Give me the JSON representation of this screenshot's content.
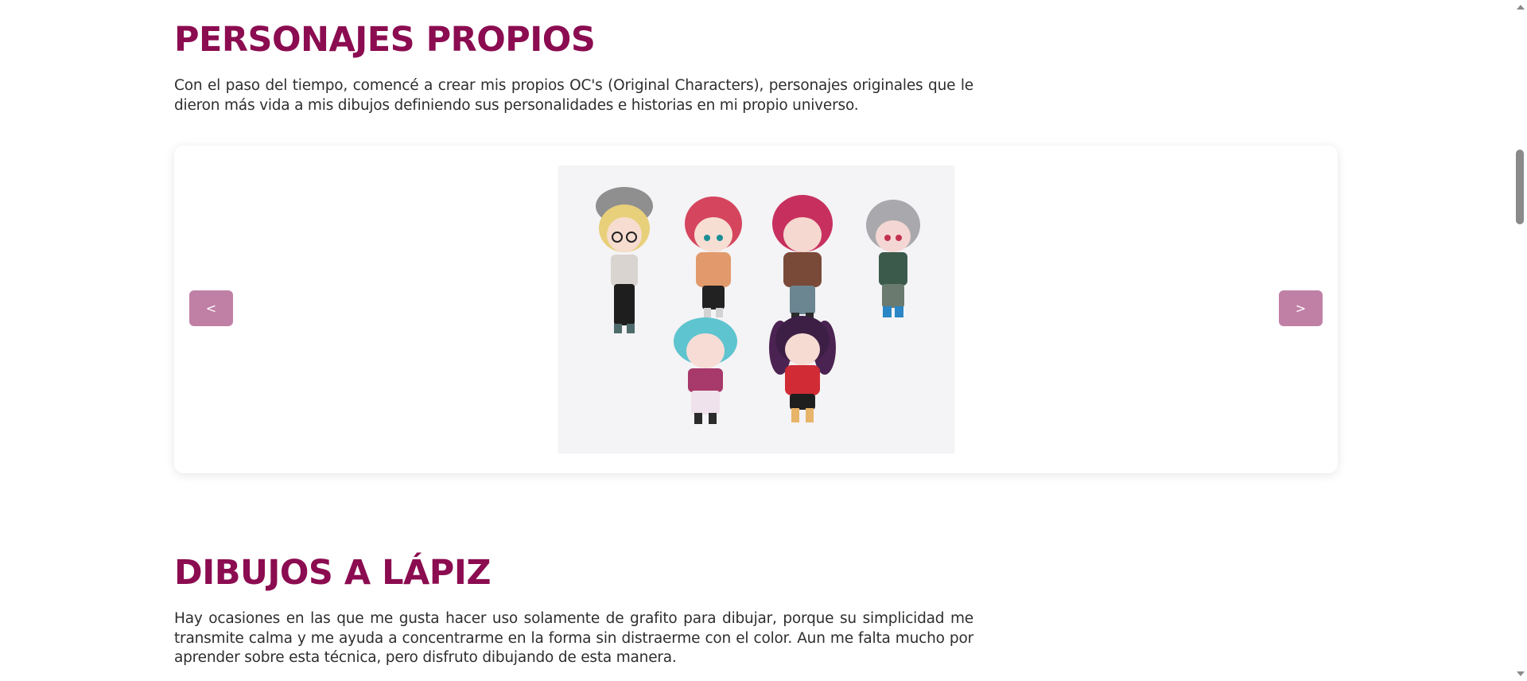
{
  "sections": [
    {
      "title": "PERSONAJES PROPIOS",
      "description": "Con el paso del tiempo, comencé a crear mis propios OC's (Original Characters), personajes originales que le dieron más vida a mis dibujos definiendo sus personalidades e historias en mi propio universo."
    },
    {
      "title": "DIBUJOS A LÁPIZ",
      "description": "Hay ocasiones en las que me gusta hacer uso solamente de grafito para dibujar, porque su simplicidad me transmite calma y me ayuda a concentrarme en la forma sin distraerme con el color. Aun me falta mucho por aprender sobre esta técnica, pero disfruto dibujando de esta manera."
    }
  ],
  "carousel": {
    "prev_label": "<",
    "next_label": ">"
  },
  "colors": {
    "heading": "#8b0c50",
    "nav_button": "#c080a6",
    "text": "#2e2e2e"
  }
}
